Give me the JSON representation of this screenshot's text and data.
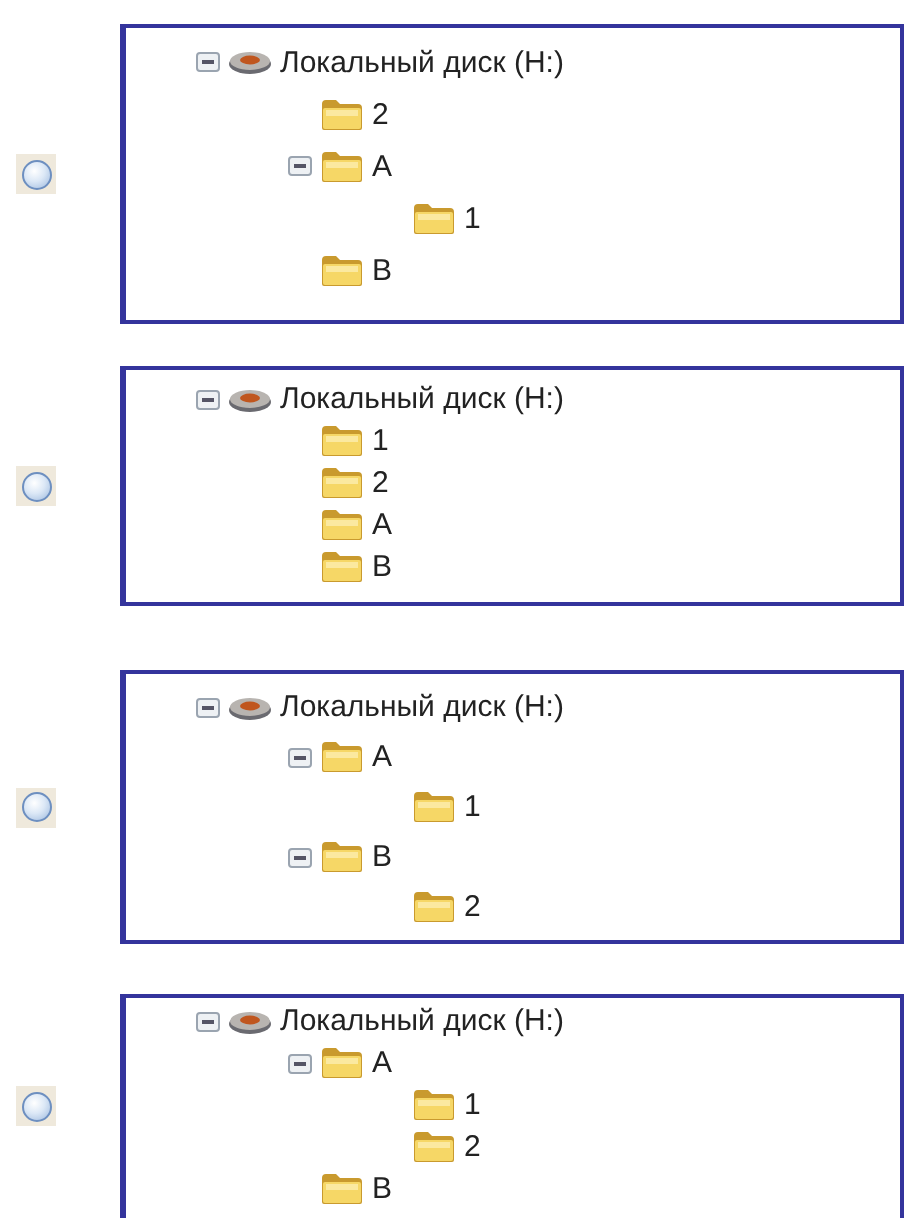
{
  "options": [
    {
      "selected": false,
      "tree": {
        "kind": "drive",
        "label": "Локальный диск (H:)",
        "expanded": true,
        "children": [
          {
            "kind": "folder",
            "label": "2"
          },
          {
            "kind": "folder",
            "label": "A",
            "expanded": true,
            "children": [
              {
                "kind": "folder",
                "label": "1"
              }
            ]
          },
          {
            "kind": "folder",
            "label": "B"
          }
        ]
      }
    },
    {
      "selected": false,
      "tree": {
        "kind": "drive",
        "label": "Локальный диск (H:)",
        "expanded": true,
        "children": [
          {
            "kind": "folder",
            "label": "1"
          },
          {
            "kind": "folder",
            "label": "2"
          },
          {
            "kind": "folder",
            "label": "A"
          },
          {
            "kind": "folder",
            "label": "B"
          }
        ]
      }
    },
    {
      "selected": false,
      "tree": {
        "kind": "drive",
        "label": "Локальный диск (H:)",
        "expanded": true,
        "children": [
          {
            "kind": "folder",
            "label": "A",
            "expanded": true,
            "children": [
              {
                "kind": "folder",
                "label": "1"
              }
            ]
          },
          {
            "kind": "folder",
            "label": "B",
            "expanded": true,
            "children": [
              {
                "kind": "folder",
                "label": "2"
              }
            ]
          }
        ]
      }
    },
    {
      "selected": false,
      "tree": {
        "kind": "drive",
        "label": "Локальный диск (H:)",
        "expanded": true,
        "children": [
          {
            "kind": "folder",
            "label": "A",
            "expanded": true,
            "children": [
              {
                "kind": "folder",
                "label": "1"
              },
              {
                "kind": "folder",
                "label": "2"
              }
            ]
          },
          {
            "kind": "folder",
            "label": "B"
          }
        ]
      }
    }
  ]
}
